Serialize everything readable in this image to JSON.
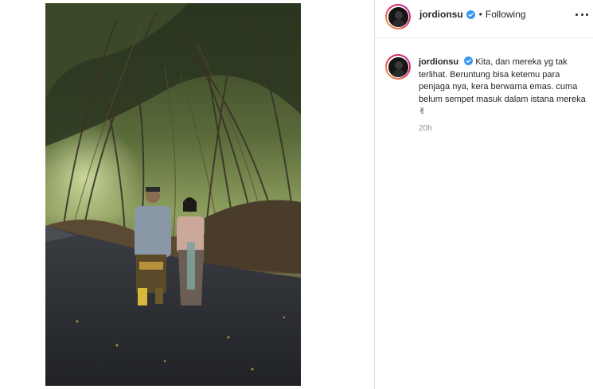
{
  "post": {
    "username": "jordionsu",
    "separator": "•",
    "follow_status": "Following",
    "caption": "Kita, dan mereka yg tak terlihat. Beruntung bisa ketemu para penjaga nya, kera berwarna emas. cuma belum sempet masuk dalam istana mereka",
    "caption_emoji": "✌",
    "timestamp": "20h"
  },
  "icons": {
    "verified": "verified-badge-icon",
    "more": "more-options-icon"
  },
  "colors": {
    "verified_blue": "#3897f0",
    "text": "#262626",
    "muted": "#8e8e8e",
    "story_ring_start": "#f7b332",
    "story_ring_end": "#b72a9b"
  }
}
